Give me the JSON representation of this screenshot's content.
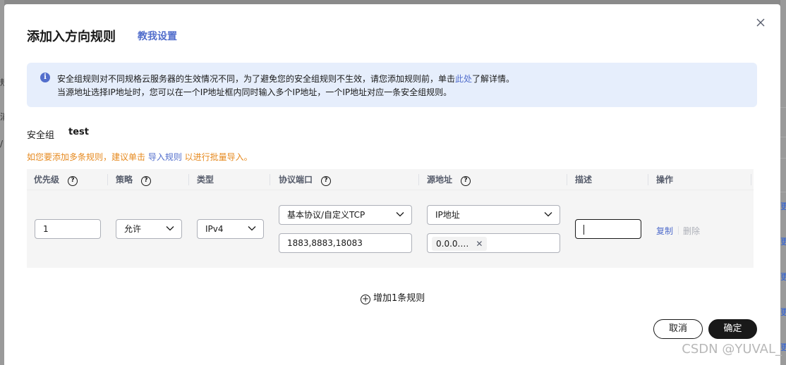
{
  "dialog": {
    "title": "添加入方向规则",
    "title_link": "教我设置",
    "close_icon": "close-icon"
  },
  "notice": {
    "line1_before": "安全组规则对不同规格云服务器的生效情况不同，为了避免您的安全组规则不生效，请您添加规则前，单击",
    "line1_link": "此处",
    "line1_after": "了解详情。",
    "line2": "当源地址选择IP地址时，您可以在一个IP地址框内同时输入多个IP地址，一个IP地址对应一条安全组规则。",
    "icon": "info-icon"
  },
  "security_group": {
    "label": "安全组",
    "value": "test"
  },
  "tip": {
    "before": "如您要添加多条规则，建议单击 ",
    "link": "导入规则",
    "after": " 以进行批量导入。"
  },
  "table": {
    "headers": {
      "priority": "优先级",
      "policy": "策略",
      "type": "类型",
      "protocol_port": "协议端口",
      "source": "源地址",
      "description": "描述",
      "actions": "操作"
    },
    "row": {
      "priority": "1",
      "policy": "允许",
      "type": "IPv4",
      "protocol": "基本协议/自定义TCP",
      "ports": "1883,8883,18083",
      "source_type": "IP地址",
      "source_ip_tag": "0.0.0.…",
      "description": "",
      "copy": "复制",
      "delete": "删除"
    }
  },
  "add_rule": "增加1条规则",
  "buttons": {
    "cancel": "取消",
    "confirm": "确定"
  },
  "watermark": "CSDN @YUVAL_",
  "background": {
    "left_frags": [
      "规",
      "消",
      "/"
    ],
    "right_frags": [
      "更",
      "更",
      "更",
      "更",
      "更"
    ]
  },
  "colors": {
    "accent": "#526ecc",
    "warning": "#e6891e",
    "primary_button": "#191919",
    "info_bg": "#e6eefc"
  }
}
